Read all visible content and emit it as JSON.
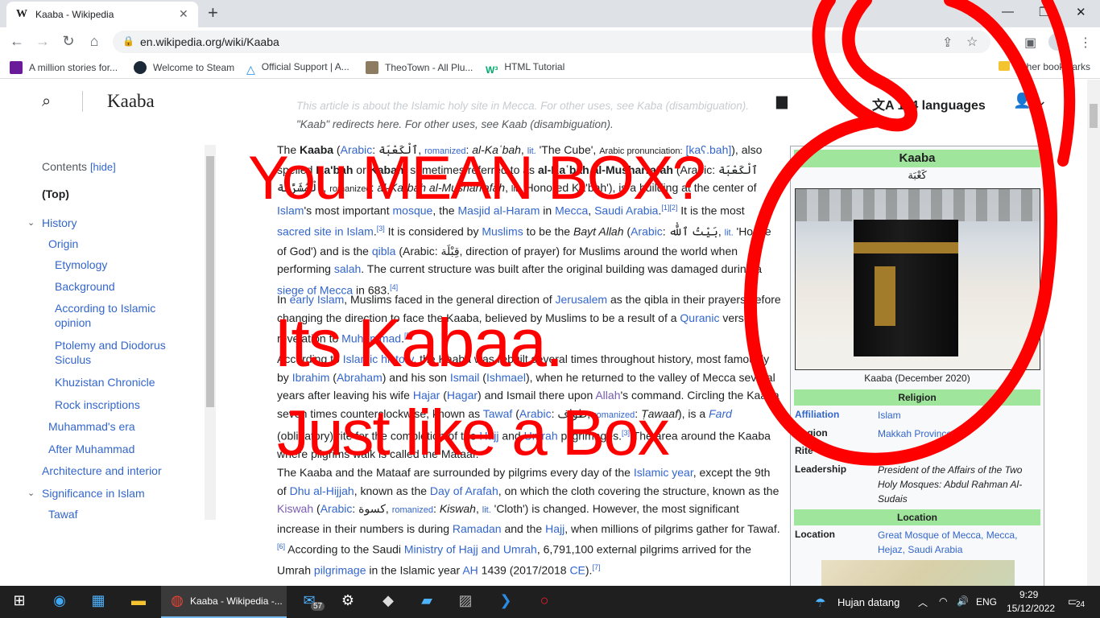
{
  "browser": {
    "tab_title": "Kaaba - Wikipedia",
    "tab_favicon": "W",
    "url": "en.wikipedia.org/wiki/Kaaba",
    "bookmarks": [
      {
        "label": "A million stories for...",
        "color": "#6a1b9a"
      },
      {
        "label": "Welcome to Steam",
        "color": "#1b2838"
      },
      {
        "label": "Official Support | A...",
        "color": "#1e88e5"
      },
      {
        "label": "TheoTown - All Plu...",
        "color": "#8d7b62"
      },
      {
        "label": "HTML Tutorial",
        "color": "#04aa6d"
      }
    ],
    "other_bookmarks": "Other bookmarks"
  },
  "wiki": {
    "header_title": "Kaaba",
    "languages": "114 languages",
    "hatnote_1": "This article is about the Islamic holy site in Mecca. For other uses, see Kaba (disambiguation).",
    "hatnote_2": "\"Kaab\" redirects here. For other uses, see Kaab (disambiguation).",
    "toc": {
      "heading": "Contents",
      "hide": "[hide]",
      "top": "(Top)",
      "items": [
        {
          "label": "History",
          "level": 1,
          "toggle": true
        },
        {
          "label": "Origin",
          "level": 2
        },
        {
          "label": "Etymology",
          "level": 3
        },
        {
          "label": "Background",
          "level": 3
        },
        {
          "label": "According to Islamic opinion",
          "level": 3
        },
        {
          "label": "Ptolemy and Diodorus Siculus",
          "level": 3
        },
        {
          "label": "Khuzistan Chronicle",
          "level": 3
        },
        {
          "label": "Rock inscriptions",
          "level": 3
        },
        {
          "label": "Muhammad's era",
          "level": 2
        },
        {
          "label": "After Muhammad",
          "level": 2
        },
        {
          "label": "Architecture and interior",
          "level": 1
        },
        {
          "label": "Significance in Islam",
          "level": 1,
          "toggle": true
        },
        {
          "label": "Tawaf",
          "level": 2
        }
      ]
    },
    "paragraphs": [
      "The Kaaba (Arabic: ٱلْكَعْبَة, romanized: al-Kaʿbah, lit. 'The Cube', Arabic pronunciation: [kaʕ.bah]), also spelled Ka'bah or Kabah, sometimes referred to as al-Kaʿbah al-Musharrafah (Arabic: ٱلْكَعْبَة ٱلْمُشَرَّفَة, romanized: al-Kaʿbah al-Musharrafah, lit. 'Honored Ka'bah'), is a building at the center of Islam's most important mosque, the Masjid al-Haram in Mecca, Saudi Arabia. It is the most sacred site in Islam. It is considered by Muslims to be the Bayt Allah (Arabic: بَيْتُ ٱللَّٰه, lit. 'House of God') and is the qibla (Arabic: قِبْلَة, direction of prayer) for Muslims around the world when performing salah. The current structure was built after the original building was damaged during a siege of Mecca in 683.[4]",
      "In early Islam, Muslims faced in the general direction of Jerusalem as the qibla in their prayers before changing the direction to face the Kaaba, believed by Muslims to be a result of a Quranic verse revelation to Muhammad.[5]",
      "According to Islamic history, the Kaaba was rebuilt several times throughout history, most famously by Ibrahim (Abraham) and his son Ismail (Ishmael), when he returned to the valley of Mecca several years after leaving his wife Hajar (Hagar) and Ismail there upon Allah's command. Circling the Kaaba seven times counterclockwise, known as Tawaf (Arabic: طواف, romanized: Ṭawaaf), is a Fard (obligatory) rite for the completion of the Hajj and Umrah pilgrimages.[3] The area around the Kaaba where pilgrims walk is called the Mataaf.",
      "The Kaaba and the Mataaf are surrounded by pilgrims every day of the Islamic year, except the 9th of Dhu al-Hijjah, known as the Day of Arafah, on which the cloth covering the structure, known as the Kiswah (Arabic: كسوة, romanized: Kiswah, lit. 'Cloth') is changed. However, the most significant increase in their numbers is during Ramadan and the Hajj, when millions of pilgrims gather for Tawaf.[6] According to the Saudi Ministry of Hajj and Umrah, 6,791,100 external pilgrims arrived for the Umrah pilgrimage in the Islamic year AH 1439 (2017/2018 CE).[7]"
    ],
    "infobox": {
      "title": "Kaaba",
      "native": "كَعْبَة",
      "caption": "Kaaba (December 2020)",
      "religion_header": "Religion",
      "affiliation_label": "Affiliation",
      "affiliation_value": "Islam",
      "region_label": "Region",
      "region_value": "Makkah Province",
      "rite_label": "Rite",
      "leadership_label": "Leadership",
      "leadership_value": "President of the Affairs of the Two Holy Mosques: Abdul Rahman Al-Sudais",
      "location_header": "Location",
      "location_label": "Location",
      "location_value": "Great Mosque of Mecca, Mecca, Hejaz, Saudi Arabia"
    }
  },
  "annotations": {
    "line1": "You MEAN BOX?",
    "line2": "Its Kabaa.",
    "line3": "Just like a Box",
    "color": "#ff0000"
  },
  "taskbar": {
    "chrome_label": "Kaaba - Wikipedia -...",
    "mail_badge": "57",
    "weather": "Hujan datang",
    "lang": "ENG",
    "time": "9:29",
    "date": "15/12/2022",
    "notification_count": "24"
  }
}
